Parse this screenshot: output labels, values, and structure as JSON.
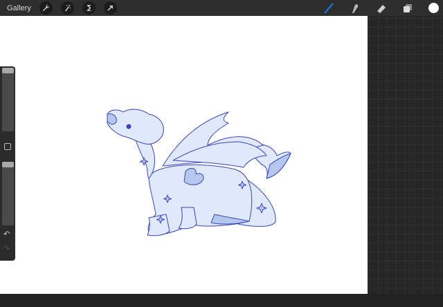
{
  "topbar": {
    "gallery_label": "Gallery",
    "left_tools": [
      "wrench-icon",
      "magic-wand-icon",
      "selection-icon",
      "transform-arrow-icon"
    ],
    "right_tools": [
      "brush-icon",
      "smudge-icon",
      "eraser-icon",
      "layers-icon"
    ],
    "active_tool": "brush",
    "accent_color": "#1a7cf5",
    "current_color": "#ffffff"
  },
  "sidebar": {
    "brush_size": 0.97,
    "opacity": 0.97,
    "controls": [
      "modify-square-icon",
      "undo-icon",
      "redo-icon"
    ]
  },
  "artwork": {
    "line_color": "#3a44b8",
    "fill_color": "#dfe9fb",
    "shade_color": "#b4c8ee"
  }
}
